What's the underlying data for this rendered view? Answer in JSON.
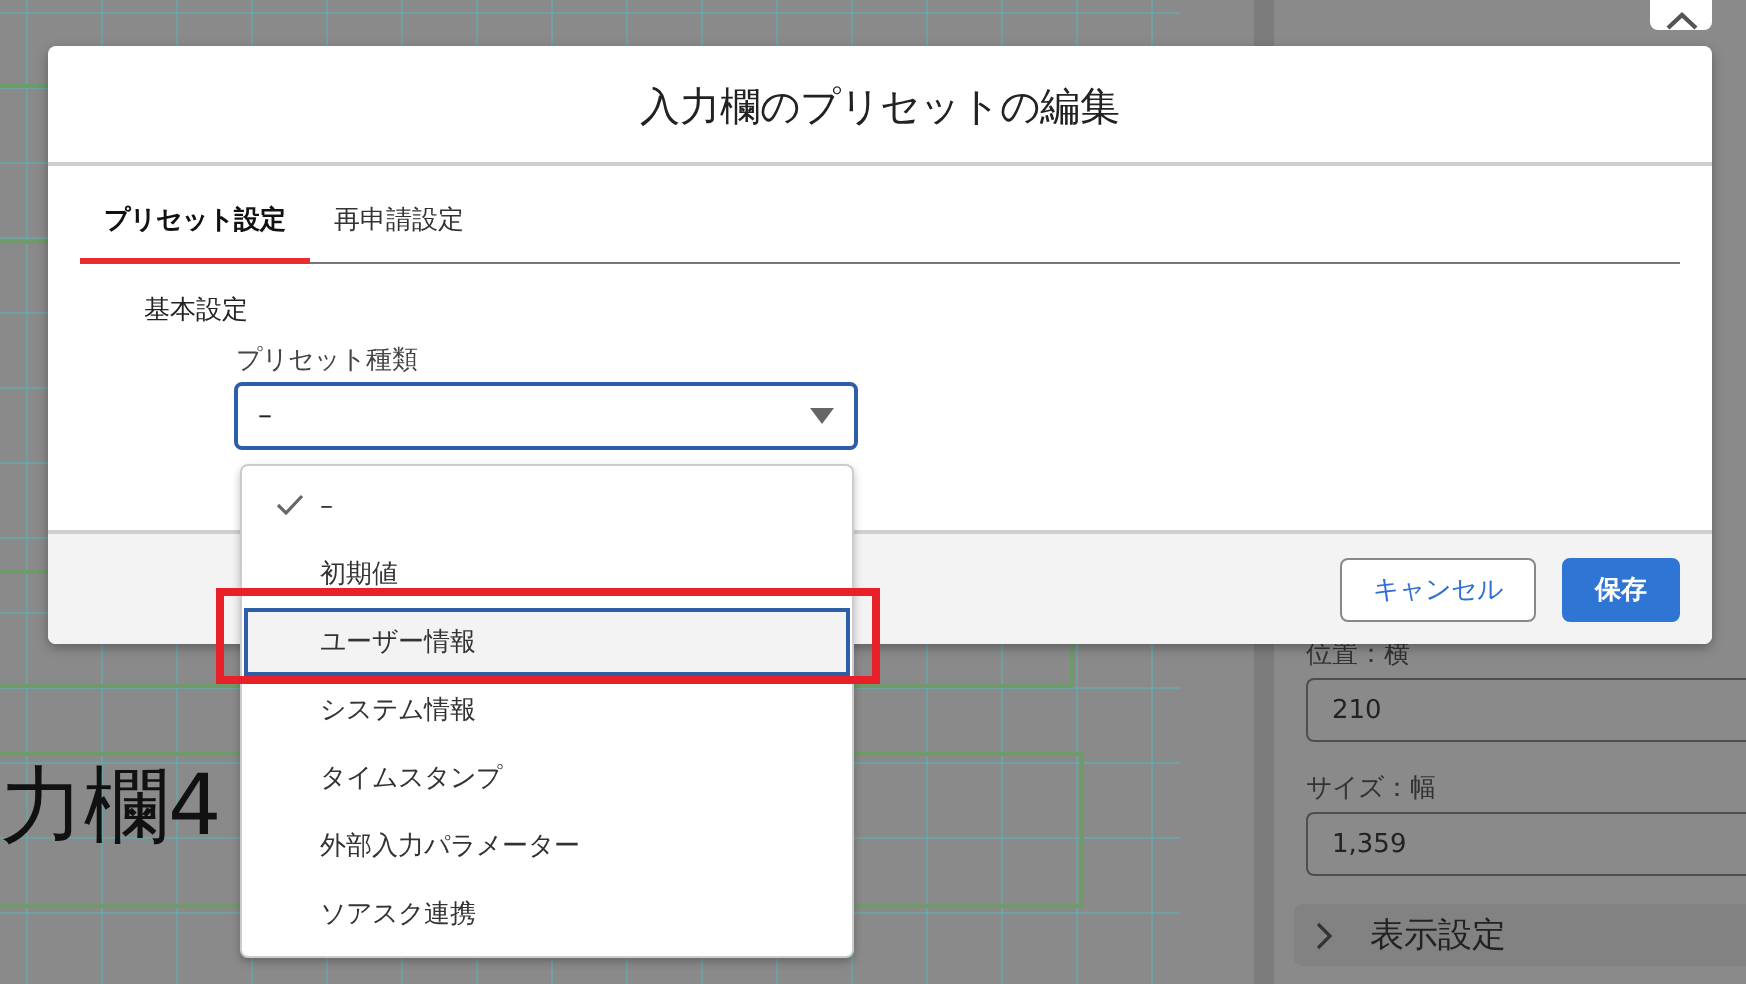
{
  "canvas": {
    "labels": [
      "力欄4"
    ]
  },
  "side_panel": {
    "fields": [
      {
        "label": "位置：横",
        "value": "210"
      },
      {
        "label": "サイズ：幅",
        "value": "1,359"
      }
    ],
    "sections": [
      {
        "title": "表示設定",
        "expanded": false
      }
    ]
  },
  "dialog": {
    "title": "入力欄のプリセットの編集",
    "tabs": [
      {
        "label": "プリセット設定",
        "selected": true
      },
      {
        "label": "再申請設定",
        "selected": false
      }
    ],
    "section_title": "基本設定",
    "select": {
      "label": "プリセット種類",
      "value": "–",
      "open": true
    },
    "options": [
      {
        "label": "–",
        "selected": true,
        "focused": false,
        "callout": false
      },
      {
        "label": "初期値",
        "selected": false,
        "focused": false,
        "callout": false
      },
      {
        "label": "ユーザー情報",
        "selected": false,
        "focused": true,
        "callout": true
      },
      {
        "label": "システム情報",
        "selected": false,
        "focused": false,
        "callout": false
      },
      {
        "label": "タイムスタンプ",
        "selected": false,
        "focused": false,
        "callout": false
      },
      {
        "label": "外部入力パラメーター",
        "selected": false,
        "focused": false,
        "callout": false
      },
      {
        "label": "ソアスク連携",
        "selected": false,
        "focused": false,
        "callout": false
      }
    ],
    "buttons": [
      {
        "label": "キャンセル",
        "kind": "secondary"
      },
      {
        "label": "保存",
        "kind": "primary"
      }
    ]
  }
}
